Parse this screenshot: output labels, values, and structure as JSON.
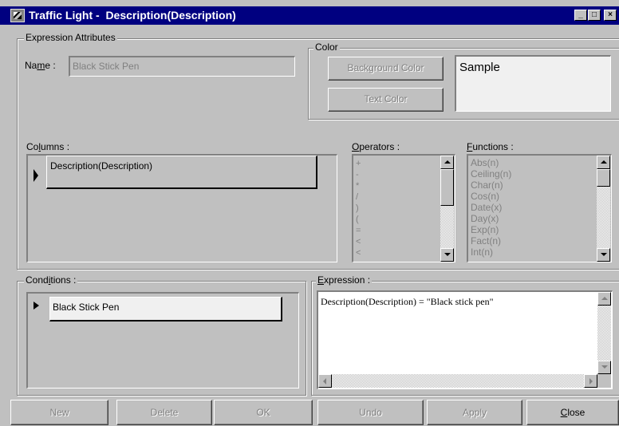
{
  "window": {
    "title": "Traffic Light -  Description(Description)",
    "minimize": "_",
    "maximize": "□",
    "close": "×"
  },
  "expression_attributes": {
    "group_label": "Expression Attributes",
    "name_label_pre": "Na",
    "name_label_ul": "m",
    "name_label_post": "e :",
    "name_value": "Black Stick Pen"
  },
  "color": {
    "group_label": "Color",
    "background_button": "Background Color",
    "text_button": "Text Color",
    "sample_text": "Sample"
  },
  "columns": {
    "label_pre": "Co",
    "label_ul": "l",
    "label_post": "umns :",
    "items": [
      "Description(Description)"
    ]
  },
  "operators": {
    "label_pre": "",
    "label_ul": "O",
    "label_post": "perators :",
    "items": [
      "+",
      "-",
      "*",
      "/",
      ")",
      "(",
      "=",
      "<",
      "<"
    ]
  },
  "functions": {
    "label_pre": "",
    "label_ul": "F",
    "label_post": "unctions :",
    "items": [
      "Abs(n)",
      "Ceiling(n)",
      "Char(n)",
      "Cos(n)",
      "Date(x)",
      "Day(x)",
      "Exp(n)",
      "Fact(n)",
      "Int(n)"
    ]
  },
  "conditions": {
    "label_pre": "Cond",
    "label_ul": "i",
    "label_post": "tions :",
    "items": [
      "Black Stick Pen"
    ]
  },
  "expression": {
    "label_pre": "",
    "label_ul": "E",
    "label_post": "xpression :",
    "text": "Description(Description) = \"Black stick pen\""
  },
  "buttons": {
    "new": "New",
    "delete": "Delete",
    "ok": "OK",
    "undo": "Undo",
    "apply": "Apply",
    "close_ul": "C",
    "close_post": "lose"
  }
}
